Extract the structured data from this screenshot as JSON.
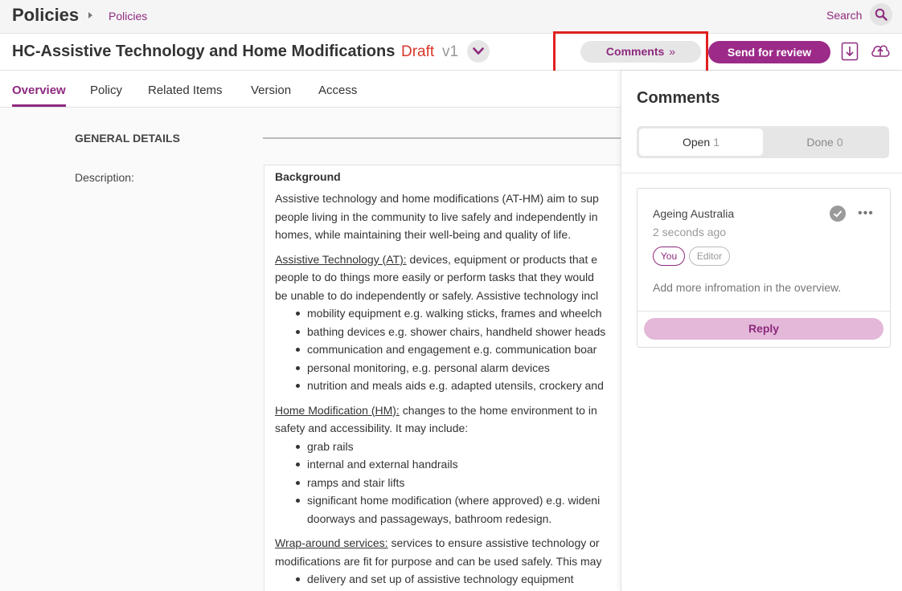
{
  "topbar": {
    "app_title": "Policies",
    "breadcrumb": "Policies",
    "search_label": "Search"
  },
  "header": {
    "doc_title": "HC-Assistive Technology and Home Modifications",
    "status": "Draft",
    "version": "v1",
    "comments_button": "Comments",
    "comments_chevrons": "»",
    "review_button": "Send for review"
  },
  "tabs": [
    {
      "label": "Overview",
      "active": true
    },
    {
      "label": "Policy"
    },
    {
      "label": "Related Items"
    },
    {
      "label": "Version"
    },
    {
      "label": "Access"
    }
  ],
  "main": {
    "section_label": "GENERAL DETAILS",
    "description_label": "Description:",
    "description": {
      "heading": "Background",
      "intro": [
        "Assistive technology and home modifications (AT-HM) aim to sup",
        "people living in the community to live safely and independently in",
        "homes, while maintaining their well-being and quality of life."
      ],
      "at_term": "Assistive Technology (AT):",
      "at_text": [
        " devices, equipment or products that e",
        "people to do things more easily or perform tasks that they would",
        "be unable to do independently or safely. Assistive technology incl"
      ],
      "at_items": [
        "mobility equipment e.g. walking sticks, frames and wheelch",
        "bathing devices e.g. shower chairs, handheld shower heads",
        "communication and engagement e.g. communication boar",
        "personal monitoring, e.g. personal alarm devices",
        "nutrition and meals aids e.g. adapted utensils, crockery and"
      ],
      "hm_term": "Home Modification (HM):",
      "hm_text": [
        " changes to the home environment to in",
        "safety and accessibility. It may include:"
      ],
      "hm_items": [
        "grab rails",
        "internal and external handrails",
        "ramps and stair lifts",
        "significant home modification (where approved) e.g. wideni"
      ],
      "hm_item_cont": "doorways and passageways, bathroom redesign.",
      "wrap_term": "Wrap-around services:",
      "wrap_text": [
        " services to ensure assistive technology or",
        "modifications are fit for purpose and can be used safely. This may"
      ],
      "wrap_items": [
        "delivery and set up of assistive technology equipment"
      ]
    }
  },
  "panel": {
    "title": "Comments",
    "open_label": "Open",
    "open_count": "1",
    "done_label": "Done",
    "done_count": "0",
    "comment": {
      "author": "Ageing Australia",
      "time": "2 seconds ago",
      "badge_you": "You",
      "badge_role": "Editor",
      "text": "Add more infromation in the overview.",
      "reply_label": "Reply"
    }
  },
  "colors": {
    "brand": "#9c2a89",
    "link": "#8e2a7f",
    "draft": "#d9362b",
    "highlight": "#e02020"
  }
}
